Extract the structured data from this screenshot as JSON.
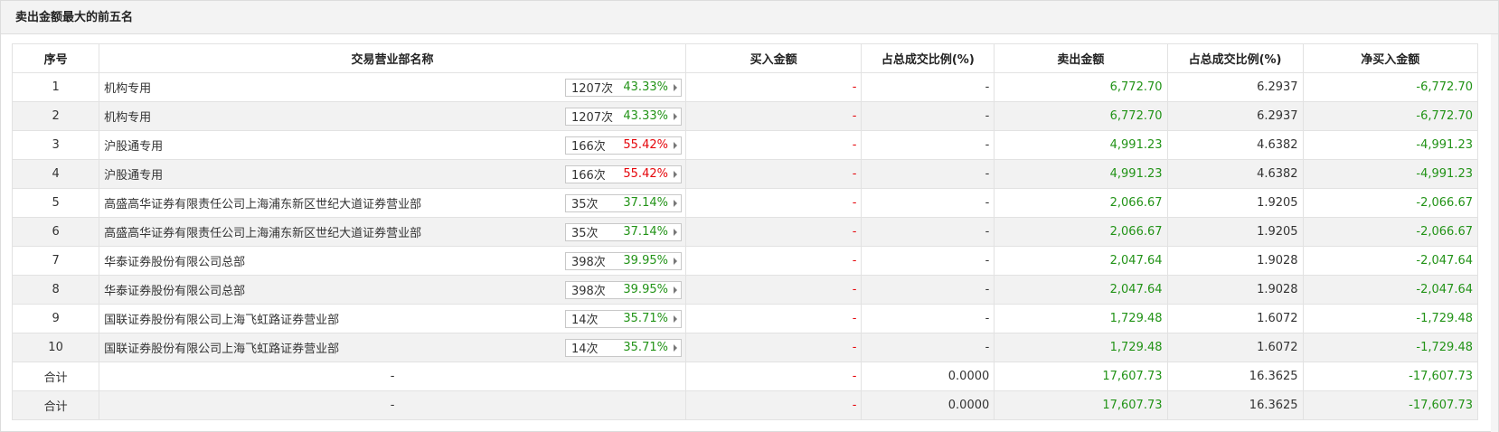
{
  "panel": {
    "title": "卖出金额最大的前五名"
  },
  "columns": [
    "序号",
    "交易营业部名称",
    "买入金额",
    "占总成交比例(%)",
    "卖出金额",
    "占总成交比例(%)",
    "净买入金额"
  ],
  "rows": [
    {
      "idx": "1",
      "name": "机构专用",
      "count": "1207次",
      "rate": "43.33%",
      "rate_color": "green",
      "buy": "-",
      "buy_pct": "-",
      "sell": "6,772.70",
      "sell_pct": "6.2937",
      "net": "-6,772.70"
    },
    {
      "idx": "2",
      "name": "机构专用",
      "count": "1207次",
      "rate": "43.33%",
      "rate_color": "green",
      "buy": "-",
      "buy_pct": "-",
      "sell": "6,772.70",
      "sell_pct": "6.2937",
      "net": "-6,772.70"
    },
    {
      "idx": "3",
      "name": "沪股通专用",
      "count": "166次",
      "rate": "55.42%",
      "rate_color": "red",
      "buy": "-",
      "buy_pct": "-",
      "sell": "4,991.23",
      "sell_pct": "4.6382",
      "net": "-4,991.23"
    },
    {
      "idx": "4",
      "name": "沪股通专用",
      "count": "166次",
      "rate": "55.42%",
      "rate_color": "red",
      "buy": "-",
      "buy_pct": "-",
      "sell": "4,991.23",
      "sell_pct": "4.6382",
      "net": "-4,991.23"
    },
    {
      "idx": "5",
      "name": "高盛高华证券有限责任公司上海浦东新区世纪大道证券营业部",
      "count": "35次",
      "rate": "37.14%",
      "rate_color": "green",
      "buy": "-",
      "buy_pct": "-",
      "sell": "2,066.67",
      "sell_pct": "1.9205",
      "net": "-2,066.67"
    },
    {
      "idx": "6",
      "name": "高盛高华证券有限责任公司上海浦东新区世纪大道证券营业部",
      "count": "35次",
      "rate": "37.14%",
      "rate_color": "green",
      "buy": "-",
      "buy_pct": "-",
      "sell": "2,066.67",
      "sell_pct": "1.9205",
      "net": "-2,066.67"
    },
    {
      "idx": "7",
      "name": "华泰证券股份有限公司总部",
      "count": "398次",
      "rate": "39.95%",
      "rate_color": "green",
      "buy": "-",
      "buy_pct": "-",
      "sell": "2,047.64",
      "sell_pct": "1.9028",
      "net": "-2,047.64"
    },
    {
      "idx": "8",
      "name": "华泰证券股份有限公司总部",
      "count": "398次",
      "rate": "39.95%",
      "rate_color": "green",
      "buy": "-",
      "buy_pct": "-",
      "sell": "2,047.64",
      "sell_pct": "1.9028",
      "net": "-2,047.64"
    },
    {
      "idx": "9",
      "name": "国联证券股份有限公司上海飞虹路证券营业部",
      "count": "14次",
      "rate": "35.71%",
      "rate_color": "green",
      "buy": "-",
      "buy_pct": "-",
      "sell": "1,729.48",
      "sell_pct": "1.6072",
      "net": "-1,729.48"
    },
    {
      "idx": "10",
      "name": "国联证券股份有限公司上海飞虹路证券营业部",
      "count": "14次",
      "rate": "35.71%",
      "rate_color": "green",
      "buy": "-",
      "buy_pct": "-",
      "sell": "1,729.48",
      "sell_pct": "1.6072",
      "net": "-1,729.48"
    }
  ],
  "totals": [
    {
      "idx": "合计",
      "name": "-",
      "buy": "-",
      "buy_pct": "0.0000",
      "sell": "17,607.73",
      "sell_pct": "16.3625",
      "net": "-17,607.73"
    },
    {
      "idx": "合计",
      "name": "-",
      "buy": "-",
      "buy_pct": "0.0000",
      "sell": "17,607.73",
      "sell_pct": "16.3625",
      "net": "-17,607.73"
    }
  ],
  "colors": {
    "positive": "#e5060b",
    "negative": "#229317",
    "header_bg": "#f3f3f3",
    "stripe_bg": "#f2f2f2"
  },
  "icons": {
    "stat_arrow": "caret-right-icon"
  }
}
